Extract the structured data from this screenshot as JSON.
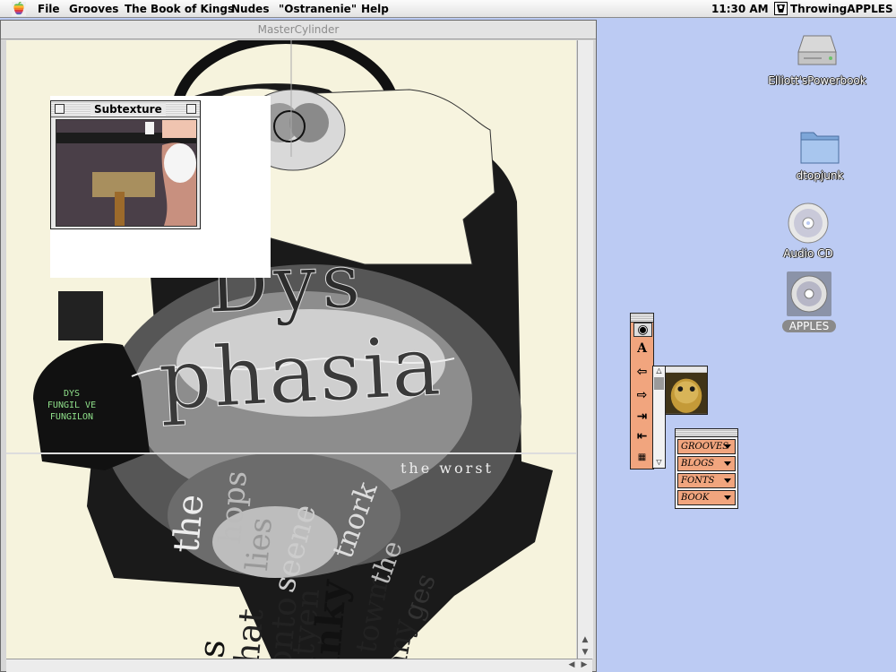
{
  "menubar": {
    "items": [
      "File",
      "Grooves",
      "The Book of Kings",
      "Nudes",
      "\"Ostranenie\"",
      "Help"
    ],
    "clock": "11:30 AM",
    "app_name": "ThrowingAPPLES"
  },
  "main_window": {
    "title": "MasterCylinder",
    "artwork": {
      "headline_1": "Dys",
      "headline_2": "phasia",
      "side_text_lines": [
        "DYS",
        "FUNGIL VE",
        "FUNGILON"
      ],
      "rotated_words": [
        "the",
        "is",
        "that",
        "hops",
        "lies",
        "onto",
        "seene",
        "atyen",
        "inky",
        "tnork",
        "towm",
        "the",
        "any",
        "ges"
      ],
      "small_caption": "the worst"
    }
  },
  "subtexture": {
    "title": "Subtexture"
  },
  "desktop": {
    "icons": [
      {
        "label": "Elliott'sPowerbook",
        "icon": "hard-drive-icon"
      },
      {
        "label": "dtopjunk",
        "icon": "folder-icon"
      },
      {
        "label": "Audio CD",
        "icon": "cd-icon"
      },
      {
        "label": "APPLES",
        "icon": "cd-icon"
      }
    ]
  },
  "tool_palette": {
    "tools": [
      "eye-icon",
      "type-icon",
      "arrow-left-icon",
      "arrow-right-icon",
      "skip-end-icon",
      "skip-start-icon",
      "pattern-icon"
    ]
  },
  "menu_palette": {
    "items": [
      "GROOVES",
      "BLOGS",
      "FONTS",
      "BOOK"
    ]
  },
  "colors": {
    "desktop": "#bccbf3",
    "palette_orange": "#f1a57e",
    "canvas_paper": "#f6f3dd"
  }
}
